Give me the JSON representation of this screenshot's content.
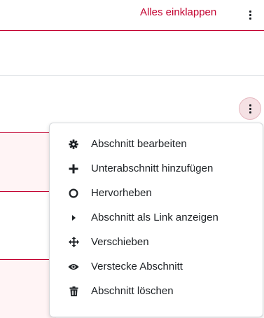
{
  "header": {
    "collapse_all_label": "Alles einklappen",
    "top_menu_icon": "kebab-menu-icon"
  },
  "section": {
    "menu_icon": "kebab-menu-icon"
  },
  "dropdown": {
    "items": [
      {
        "label": "Abschnitt bearbeiten",
        "icon": "gear-icon"
      },
      {
        "label": "Unterabschnitt hinzufügen",
        "icon": "plus-icon"
      },
      {
        "label": "Hervorheben",
        "icon": "circle-outline-icon"
      },
      {
        "label": "Abschnitt als Link anzeigen",
        "icon": "caret-right-icon"
      },
      {
        "label": "Verschieben",
        "icon": "move-arrows-icon"
      },
      {
        "label": "Verstecke Abschnitt",
        "icon": "eye-icon"
      },
      {
        "label": "Abschnitt löschen",
        "icon": "trash-icon"
      }
    ]
  },
  "colors": {
    "accent": "#c3002f",
    "section_background": "#fff4f5",
    "kebab_active_background": "#f5e1e4"
  }
}
